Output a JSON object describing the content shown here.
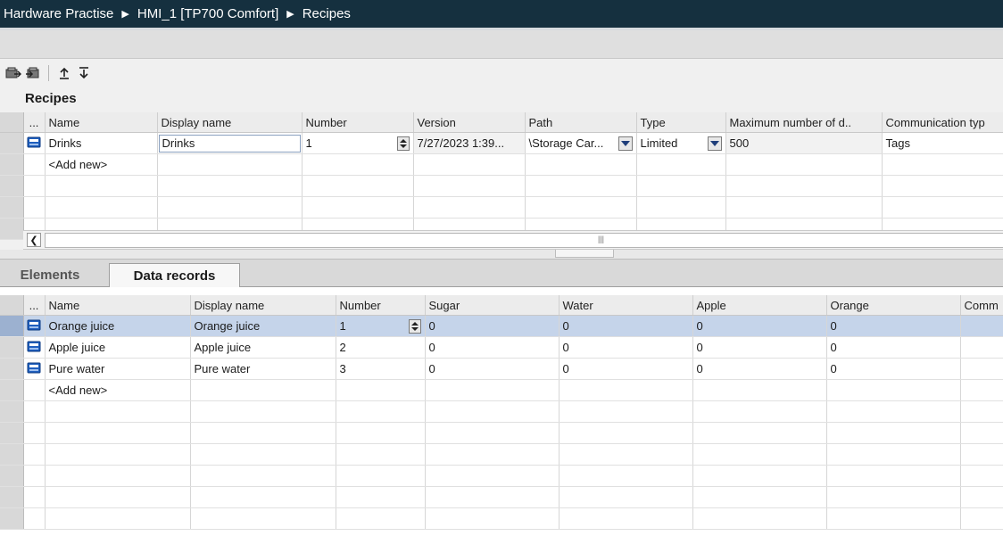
{
  "breadcrumb": {
    "items": [
      "Hardware Practise",
      "HMI_1 [TP700 Comfort]",
      "Recipes"
    ],
    "separator": "▶"
  },
  "section_title": "Recipes",
  "recipes_table": {
    "dots": "...",
    "columns": [
      "Name",
      "Display name",
      "Number",
      "Version",
      "Path",
      "Type",
      "Maximum number of d..",
      "Communication typ"
    ],
    "rows": [
      {
        "name": "Drinks",
        "display_name": "Drinks",
        "number": "1",
        "version": "7/27/2023 1:39...",
        "path": "\\Storage Car...",
        "type": "Limited",
        "max": "500",
        "comm": "Tags"
      }
    ],
    "add_new": "<Add new>"
  },
  "tabs": {
    "elements": "Elements",
    "data_records": "Data records"
  },
  "records_table": {
    "dots": "...",
    "columns": [
      "Name",
      "Display name",
      "Number",
      "Sugar",
      "Water",
      "Apple",
      "Orange",
      "Comm"
    ],
    "rows": [
      {
        "name": "Orange juice",
        "display_name": "Orange juice",
        "number": "1",
        "sugar": "0",
        "water": "0",
        "apple": "0",
        "orange": "0"
      },
      {
        "name": "Apple juice",
        "display_name": "Apple juice",
        "number": "2",
        "sugar": "0",
        "water": "0",
        "apple": "0",
        "orange": "0"
      },
      {
        "name": "Pure water",
        "display_name": "Pure water",
        "number": "3",
        "sugar": "0",
        "water": "0",
        "apple": "0",
        "orange": "0"
      }
    ],
    "add_new": "<Add new>"
  },
  "colors": {
    "title_bar": "#15303f",
    "selection": "#c5d4ea",
    "icon_blue": "#1f5fbf"
  }
}
